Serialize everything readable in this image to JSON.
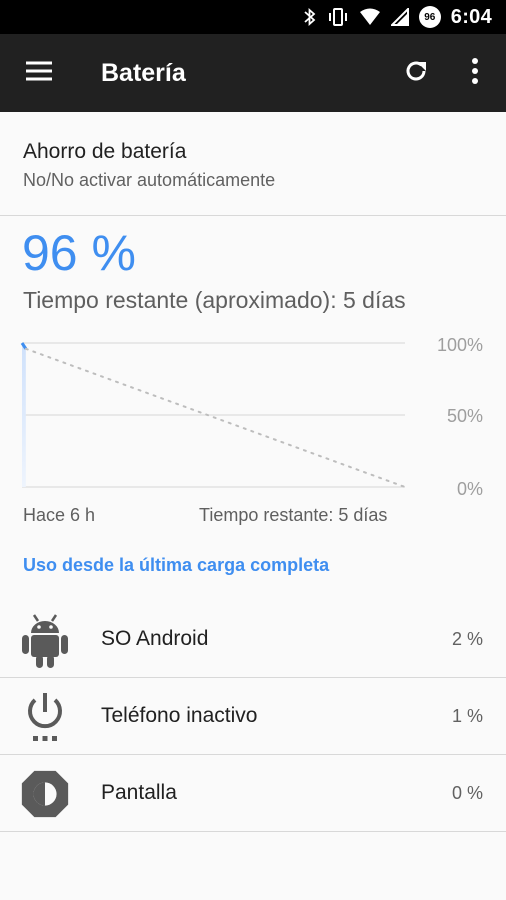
{
  "status_bar": {
    "time": "6:04",
    "battery_level": "96"
  },
  "toolbar": {
    "title": "Batería",
    "menu_icon": "menu-icon",
    "refresh_icon": "refresh-icon",
    "more_icon": "more-vert-icon"
  },
  "battery_saver": {
    "title": "Ahorro de batería",
    "subtitle": "No/No activar automáticamente"
  },
  "summary": {
    "percent": "96 %",
    "remaining": "Tiempo restante (aproximado): 5 días"
  },
  "chart_data": {
    "type": "area",
    "y_ticks": [
      "100%",
      "50%",
      "0%"
    ],
    "ylim": [
      0,
      100
    ],
    "x_start_label": "Hace 6 h",
    "x_end_label": "Tiempo restante: 5 días",
    "history_series": {
      "x": [
        0,
        1
      ],
      "y": [
        100,
        96
      ]
    },
    "projection_series": {
      "x": [
        1,
        100
      ],
      "y": [
        96,
        0
      ],
      "style": "dotted"
    },
    "history_color": "#3f8ef0",
    "projection_color": "#bdbdbd",
    "grid": true
  },
  "usage_section": {
    "title": "Uso desde la última carga completa",
    "items": [
      {
        "name": "SO Android",
        "percent": "2 %",
        "icon": "android-icon"
      },
      {
        "name": "Teléfono inactivo",
        "percent": "1 %",
        "icon": "power-idle-icon"
      },
      {
        "name": "Pantalla",
        "percent": "0 %",
        "icon": "brightness-icon"
      }
    ]
  },
  "colors": {
    "accent": "#3f8ef0",
    "toolbar": "#212121",
    "status_bar": "#000000"
  }
}
